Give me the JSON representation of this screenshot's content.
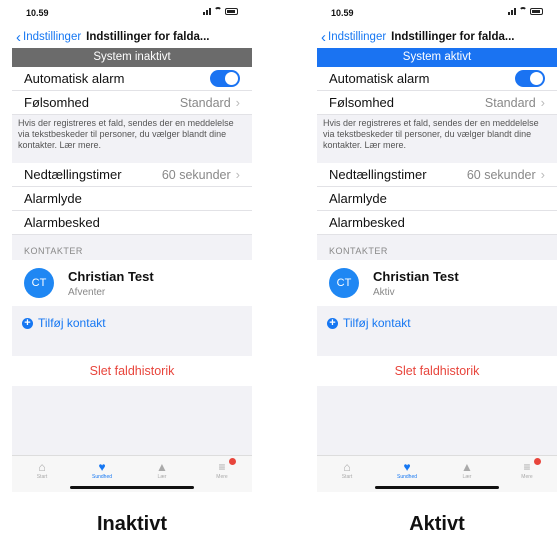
{
  "colors": {
    "inactive_bar": "#6b6b6b",
    "active_bar": "#1a73f2",
    "accent": "#1677f2",
    "danger": "#e8453c"
  },
  "screens": [
    {
      "status": {
        "time": "10.59"
      },
      "nav": {
        "back_label": "Indstillinger",
        "title": "Indstillinger for falda..."
      },
      "system_status": "System inaktivt",
      "automatic_alarm": {
        "label": "Automatisk alarm",
        "enabled": true
      },
      "sensitivity": {
        "label": "Følsomhed",
        "value": "Standard"
      },
      "description": "Hvis der registreres et fald, sendes der en meddelelse via tekstbeskeder til personer, du vælger blandt dine kontakter. Lær mere.",
      "countdown": {
        "label": "Nedtællingstimer",
        "value": "60 sekunder"
      },
      "alarm_sound": "Alarmlyde",
      "alarm_message": "Alarmbesked",
      "contacts_header": "KONTAKTER",
      "contact": {
        "initials": "CT",
        "name": "Christian Test",
        "status": "Afventer"
      },
      "add_contact": "Tilføj kontakt",
      "delete_history": "Slet faldhistorik",
      "tabs": [
        {
          "icon": "home-icon",
          "label": "Start"
        },
        {
          "icon": "heart-icon",
          "label": "Sundhed"
        },
        {
          "icon": "graduation-cap-icon",
          "label": "Lær"
        },
        {
          "icon": "menu-icon",
          "label": "Mere"
        }
      ],
      "caption": "Inaktivt"
    },
    {
      "status": {
        "time": "10.59"
      },
      "nav": {
        "back_label": "Indstillinger",
        "title": "Indstillinger for falda..."
      },
      "system_status": "System aktivt",
      "automatic_alarm": {
        "label": "Automatisk alarm",
        "enabled": true
      },
      "sensitivity": {
        "label": "Følsomhed",
        "value": "Standard"
      },
      "description": "Hvis der registreres et fald, sendes der en meddelelse via tekstbeskeder til personer, du vælger blandt dine kontakter. Lær mere.",
      "countdown": {
        "label": "Nedtællingstimer",
        "value": "60 sekunder"
      },
      "alarm_sound": "Alarmlyde",
      "alarm_message": "Alarmbesked",
      "contacts_header": "KONTAKTER",
      "contact": {
        "initials": "CT",
        "name": "Christian Test",
        "status": "Aktiv"
      },
      "add_contact": "Tilføj kontakt",
      "delete_history": "Slet faldhistorik",
      "tabs": [
        {
          "icon": "home-icon",
          "label": "Start"
        },
        {
          "icon": "heart-icon",
          "label": "Sundhed"
        },
        {
          "icon": "graduation-cap-icon",
          "label": "Lær"
        },
        {
          "icon": "menu-icon",
          "label": "Mere"
        }
      ],
      "caption": "Aktivt"
    }
  ]
}
